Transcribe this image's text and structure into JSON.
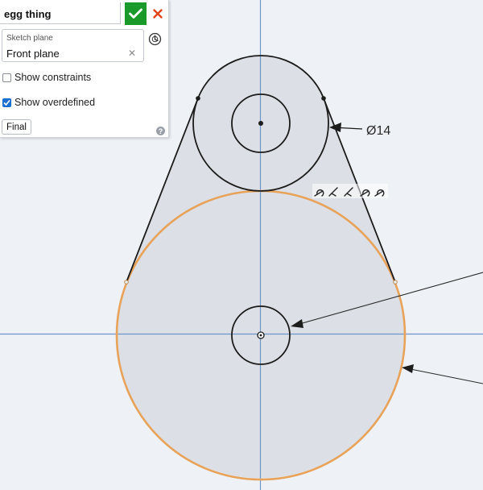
{
  "feature_dialog": {
    "name": "egg thing",
    "sketch_plane_label": "Sketch plane",
    "sketch_plane_value": "Front plane",
    "show_constraints_label": "Show constraints",
    "show_constraints_checked": false,
    "show_overdefined_label": "Show overdefined",
    "show_overdefined_checked": true,
    "final_label": "Final",
    "icons": {
      "confirm": "checkmark-icon",
      "cancel": "close-icon",
      "clear": "clear-icon",
      "plane": "sketch-plane-icon",
      "help": "help-icon"
    }
  },
  "sketch": {
    "dimension_label": "Ø14",
    "colors": {
      "background": "#eef1f6",
      "axis": "#6f95c8",
      "geometry": "#1c1c1c",
      "overdefined": "#e8a35a",
      "fill": "#dcdfe5"
    }
  }
}
